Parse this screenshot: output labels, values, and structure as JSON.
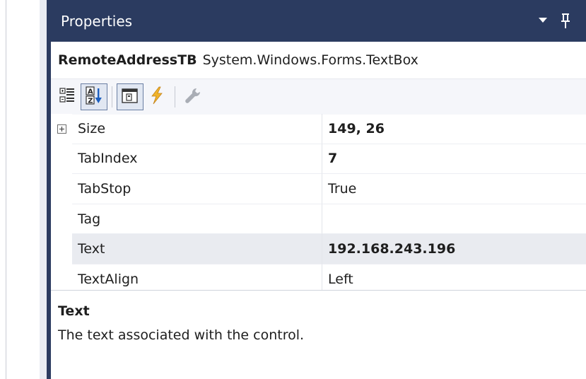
{
  "panel": {
    "title": "Properties",
    "accent_color": "#2b3b60",
    "controls": [
      "dropdown-icon",
      "pin-icon"
    ]
  },
  "object": {
    "name": "RemoteAddressTB",
    "type": "System.Windows.Forms.TextBox"
  },
  "toolbar": {
    "buttons": [
      {
        "name": "categorized-icon",
        "active": false
      },
      {
        "name": "alphabetical-icon",
        "active": true
      },
      {
        "name": "properties-icon",
        "active": true
      },
      {
        "name": "events-icon",
        "active": false
      },
      {
        "name": "property-pages-icon",
        "active": false
      }
    ]
  },
  "grid": {
    "rows": [
      {
        "name": "Size",
        "value": "149, 26",
        "bold": true,
        "expandable": true,
        "selected": false
      },
      {
        "name": "TabIndex",
        "value": "7",
        "bold": true,
        "expandable": false,
        "selected": false
      },
      {
        "name": "TabStop",
        "value": "True",
        "bold": false,
        "expandable": false,
        "selected": false
      },
      {
        "name": "Tag",
        "value": "",
        "bold": false,
        "expandable": false,
        "selected": false
      },
      {
        "name": "Text",
        "value": "192.168.243.196",
        "bold": true,
        "expandable": false,
        "selected": true
      },
      {
        "name": "TextAlign",
        "value": "Left",
        "bold": false,
        "expandable": false,
        "selected": false
      }
    ]
  },
  "description": {
    "title": "Text",
    "text": "The text associated with the control."
  }
}
